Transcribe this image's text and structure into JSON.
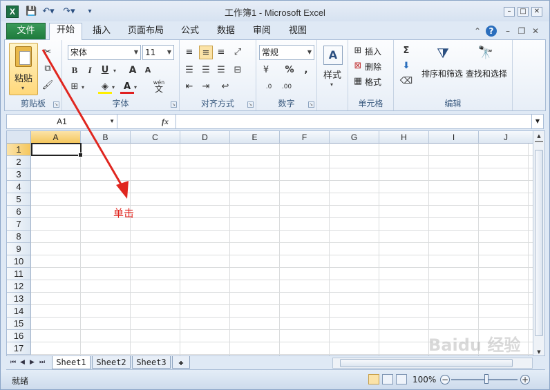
{
  "window": {
    "title": "工作簿1 - Microsoft Excel",
    "app_icon": "X"
  },
  "qat": {
    "save_icon": "save-icon",
    "undo_icon": "undo-icon",
    "redo_icon": "redo-icon"
  },
  "tabs": {
    "file": "文件",
    "items": [
      "开始",
      "插入",
      "页面布局",
      "公式",
      "数据",
      "审阅",
      "视图"
    ]
  },
  "ribbon": {
    "clipboard": {
      "label": "剪贴板",
      "paste": "粘贴"
    },
    "font": {
      "label": "字体",
      "name": "宋体",
      "size": "11",
      "bold": "B",
      "italic": "I",
      "underline": "U",
      "grow": "A",
      "shrink": "A",
      "color_a": "A",
      "wen": "wén",
      "wen_char": "文"
    },
    "alignment": {
      "label": "对齐方式"
    },
    "number": {
      "label": "数字",
      "format": "常规",
      "percent": "%",
      "comma": ",",
      "inc": ".0",
      "dec": ".00"
    },
    "styles": {
      "label": "样式"
    },
    "cells": {
      "label": "单元格",
      "insert": "插入",
      "delete": "删除",
      "format": "格式"
    },
    "editing": {
      "label": "编辑",
      "sort_filter": "排序和筛选",
      "find_select": "查找和选择",
      "sigma": "Σ"
    }
  },
  "formula_bar": {
    "name_box": "A1",
    "fx": "fx",
    "formula": ""
  },
  "grid": {
    "columns": [
      "A",
      "B",
      "C",
      "D",
      "E",
      "F",
      "G",
      "H",
      "I",
      "J"
    ],
    "rows": [
      "1",
      "2",
      "3",
      "4",
      "5",
      "6",
      "7",
      "8",
      "9",
      "10",
      "11",
      "12",
      "13",
      "14",
      "15",
      "16",
      "17"
    ]
  },
  "sheets": [
    "Sheet1",
    "Sheet2",
    "Sheet3"
  ],
  "status": {
    "ready": "就绪",
    "zoom": "100%",
    "zoom_out": "−",
    "zoom_in": "+"
  },
  "annotation": {
    "text": "单击"
  },
  "watermark": {
    "text": "Baidu 经验"
  },
  "colors": {
    "file_tab": "#1d7a3b",
    "annotation": "#e0261f",
    "selected_header": "#f5c75e"
  }
}
